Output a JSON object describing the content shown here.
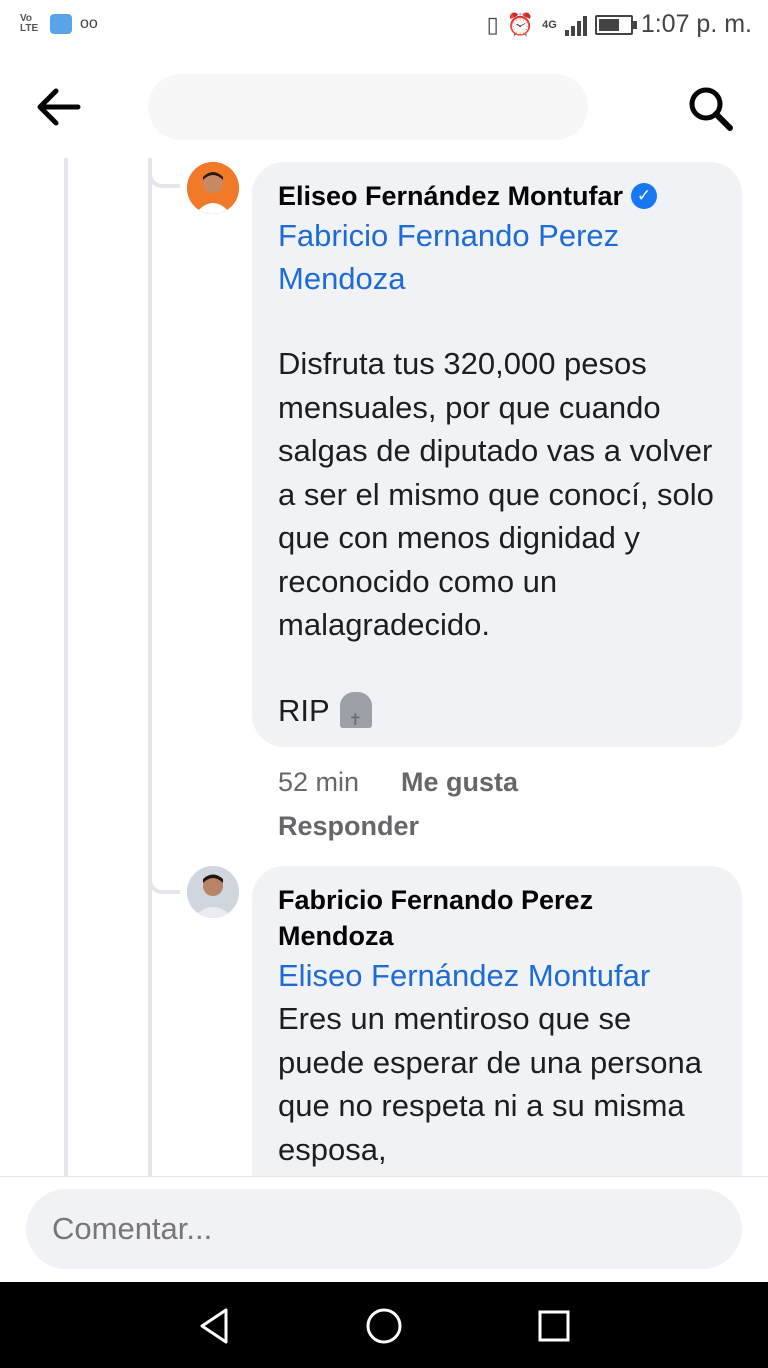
{
  "status_bar": {
    "volte_label": "Vo LTE",
    "time": "1:07 p. m.",
    "network": "4G"
  },
  "top_bar": {
    "back_icon": "arrow-left-icon",
    "search_icon": "search-icon"
  },
  "comments": [
    {
      "author": "Eliseo Fernández Montufar",
      "verified": true,
      "mention": "Fabricio Fernando Perez Mendoza",
      "text": "Disfruta tus 320,000 pesos mensuales, por que cuando salgas de diputado vas a volver a ser el mismo que conocí, solo que con menos dignidad y reconocido como un malagradecido.",
      "footer_text": "RIP",
      "footer_emoji": "headstone",
      "time": "52 min",
      "like_label": "Me gusta",
      "reply_label": "Responder"
    },
    {
      "author": "Fabricio Fernando Perez Mendoza",
      "verified": false,
      "mention": "Eliseo Fernández Montufar",
      "text": "Eres un mentiroso que se puede esperar de una persona que no respeta ni a su misma esposa,"
    }
  ],
  "composer": {
    "placeholder": "Comentar..."
  },
  "nav": {
    "back": "triangle-back-icon",
    "home": "circle-home-icon",
    "recents": "square-recents-icon"
  },
  "colors": {
    "link": "#1e6bd6",
    "bubble": "#f0f2f5",
    "verified": "#1877f2"
  }
}
